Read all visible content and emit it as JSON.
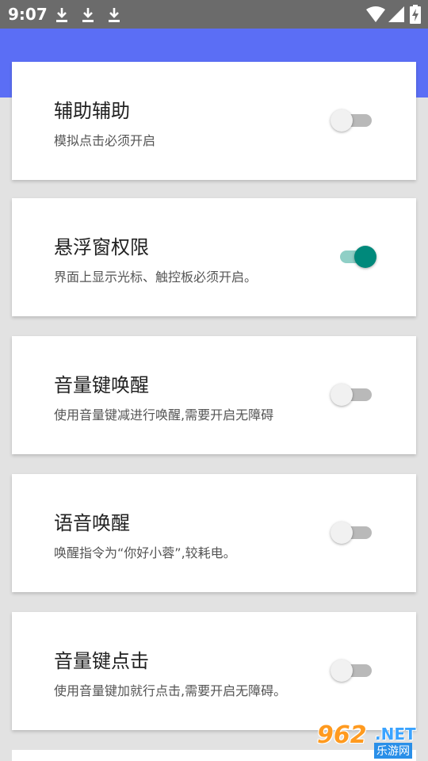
{
  "status_bar": {
    "time": "9:07"
  },
  "cards": [
    {
      "title": "辅助辅助",
      "description": "模拟点击必须开启",
      "enabled": false
    },
    {
      "title": "悬浮窗权限",
      "description": "界面上显示光标、触控板必须开启。",
      "enabled": true
    },
    {
      "title": "音量键唤醒",
      "description": "使用音量键减进行唤醒,需要开启无障碍",
      "enabled": false
    },
    {
      "title": "语音唤醒",
      "description": "唤醒指令为“你好小蓉”,较耗电。",
      "enabled": false
    },
    {
      "title": "音量键点击",
      "description": "使用音量键加就行点击,需要开启无障碍。",
      "enabled": false
    }
  ],
  "watermark": {
    "number": "962",
    "net": ".NET",
    "site": "乐游网"
  },
  "colors": {
    "app_bar": "#5b6ef5",
    "switch_on_thumb": "#00897b",
    "switch_on_track": "#8fcfc6",
    "switch_off_track": "#b9b9b9"
  }
}
